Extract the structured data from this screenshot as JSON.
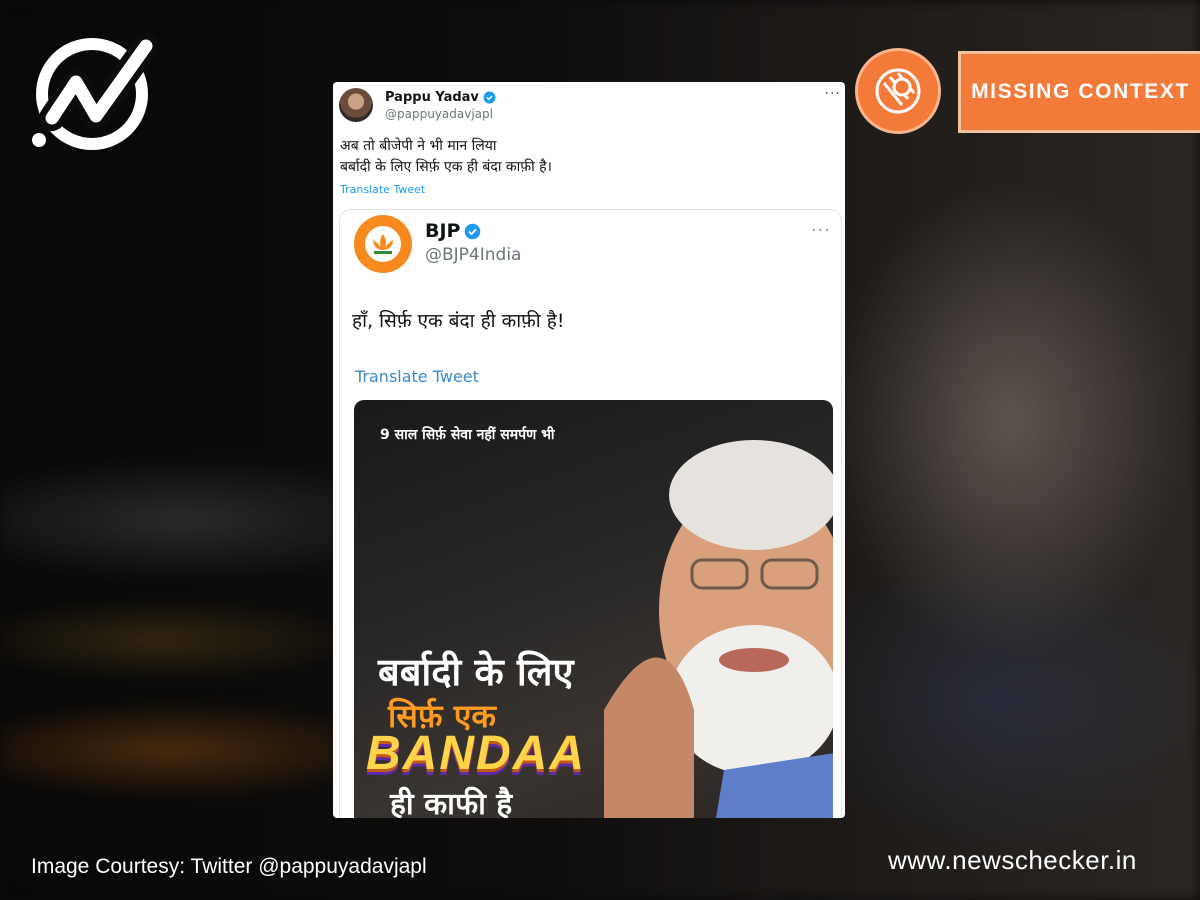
{
  "badge": {
    "label": "MISSING CONTEXT"
  },
  "outer_tweet": {
    "name": "Pappu Yadav",
    "handle": "@pappuyadavjapl",
    "more": "···",
    "text_line1": "अब तो बीजेपी ने भी मान लिया",
    "text_line2": "बर्बादी के लिए सिर्फ़ एक ही बंदा काफ़ी है।",
    "translate": "Translate Tweet"
  },
  "quoted_tweet": {
    "name": "BJP",
    "handle": "@BJP4India",
    "more": "···",
    "text": "हाँ, सिर्फ़ एक बंदा ही काफ़ी है!",
    "translate": "Translate Tweet"
  },
  "media": {
    "top_text": "9 साल सिर्फ़ सेवा नहीं समर्पण भी",
    "line1": "बर्बादी के लिए",
    "line2": "सिर्फ़ एक",
    "line3": "BANDAA",
    "line4": "ही काफी है"
  },
  "captions": {
    "left": "Image Courtesy: Twitter @pappuyadavjapl",
    "right": "www.newschecker.in"
  },
  "colors": {
    "badge": "#f47a3a",
    "verified": "#1d9bf0",
    "bjp_orange": "#f68a1e"
  }
}
